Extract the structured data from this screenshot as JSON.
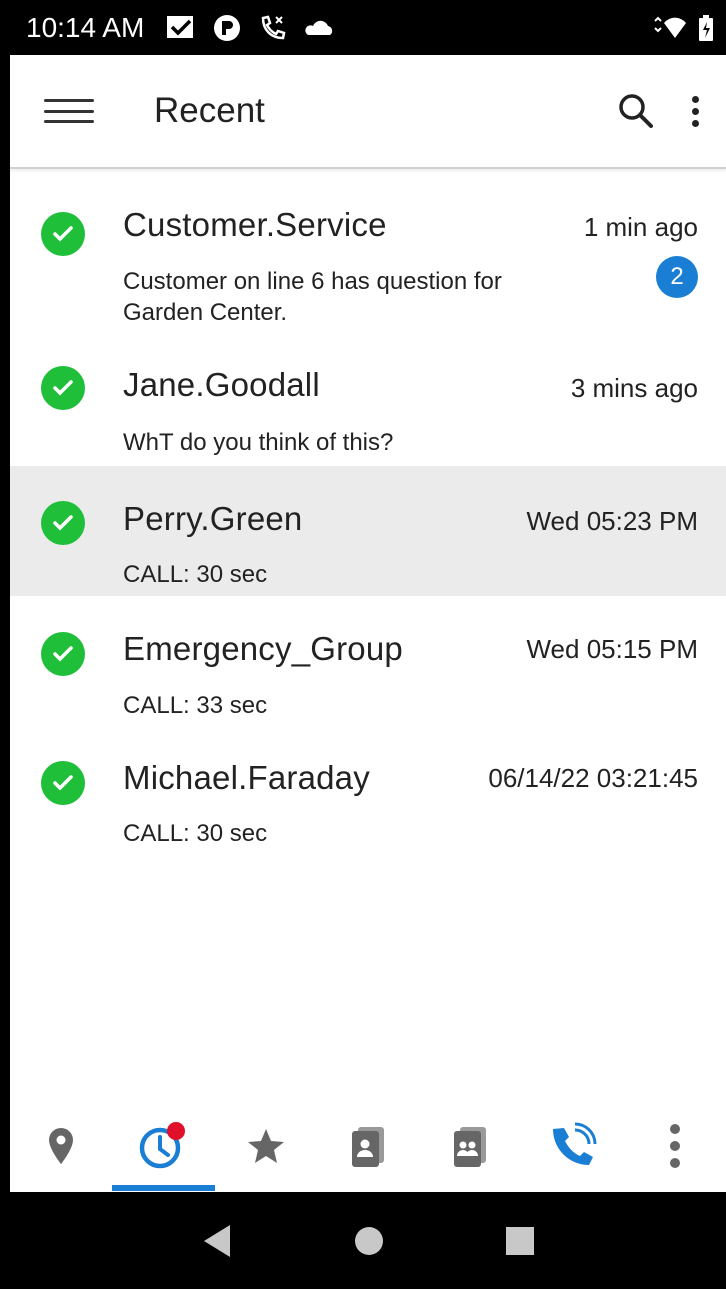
{
  "status_bar": {
    "time": "10:14 AM"
  },
  "app_bar": {
    "title": "Recent"
  },
  "recent": [
    {
      "name": "Customer.Service",
      "time": "1 min ago",
      "message": "Customer on line 6 has question for Garden Center.",
      "badge": "2",
      "selected": false
    },
    {
      "name": "Jane.Goodall",
      "time": "3 mins ago",
      "message": "WhT do you think of this?",
      "selected": false
    },
    {
      "name": "Perry.Green",
      "time": "Wed 05:23 PM",
      "message": "CALL: 30 sec",
      "selected": true
    },
    {
      "name": "Emergency_Group",
      "time": "Wed 05:15 PM",
      "message": "CALL: 33 sec",
      "selected": false
    },
    {
      "name": "Michael.Faraday",
      "time": "06/14/22 03:21:45",
      "message": "CALL: 30 sec",
      "selected": false
    }
  ],
  "tabs": [
    {
      "icon": "location-pin-icon",
      "active": false
    },
    {
      "icon": "recent-clock-icon",
      "active": true
    },
    {
      "icon": "favorites-star-icon",
      "active": false
    },
    {
      "icon": "contacts-icon",
      "active": false
    },
    {
      "icon": "groups-icon",
      "active": false
    },
    {
      "icon": "call-icon",
      "active": false
    },
    {
      "icon": "more-icon",
      "active": false
    }
  ],
  "colors": {
    "accent": "#1a7fd4",
    "online": "#1fbf3a",
    "selected_row": "#ebebeb",
    "notification_dot": "#e0102a"
  }
}
